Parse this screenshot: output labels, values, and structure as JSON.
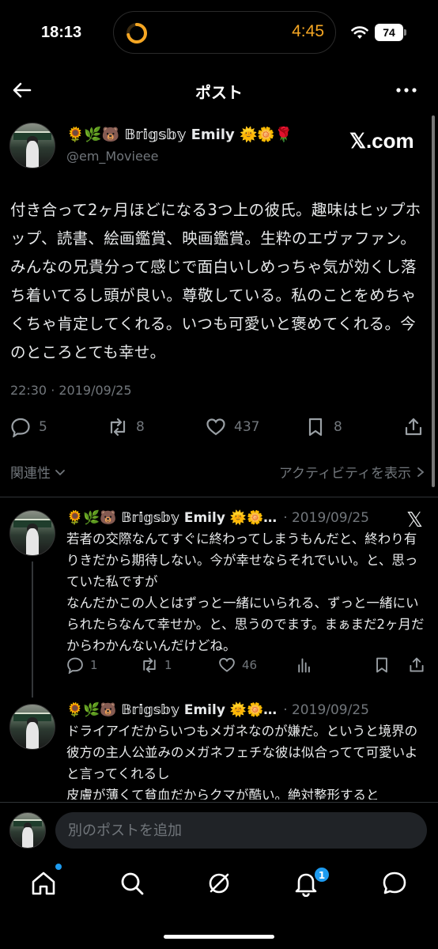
{
  "status": {
    "time": "18:13",
    "island_time": "4:45",
    "battery": "74"
  },
  "header": {
    "title": "ポスト"
  },
  "post": {
    "author_name": "🌻🌿🐻 𝔹𝕣𝕚𝕘𝕤𝕓𝕪 Emily 🌞🌼🌹",
    "handle": "@em_Movieee",
    "source": "𝕏.com",
    "body": "付き合って2ヶ月ほどになる3つ上の彼氏。趣味はヒップホップ、読書、絵画鑑賞、映画鑑賞。生粋のエヴァファン。みんなの兄貴分って感じで面白いしめっちゃ気が効くし落ち着いてるし頭が良い。尊敬している。私のことをめちゃくちゃ肯定してくれる。いつも可愛いと褒めてくれる。今のところとても幸せ。",
    "timestamp": "22:30 · 2019/09/25",
    "stats": {
      "replies": "5",
      "reposts": "8",
      "likes": "437",
      "bookmarks": "8"
    }
  },
  "filters": {
    "relevance": "関連性",
    "activity": "アクティビティを表示"
  },
  "replies": [
    {
      "author_name": "🌻🌿🐻 𝔹𝕣𝕚𝕘𝕤𝕓𝕪 Emily 🌞🌼…",
      "date": "· 2019/09/25",
      "source": "𝕏",
      "body": "若者の交際なんてすぐに終わってしまうもんだと、終わり有りきだから期待しない。今が幸せならそれでいい。と、思っていた私ですが\nなんだかこの人とはずっと一緒にいられる、ずっと一緒にいられたらなんて幸せか。と、思うのでます。まぁまだ2ヶ月だからわかんないんだけどね。",
      "stats": {
        "replies": "1",
        "reposts": "1",
        "likes": "46"
      }
    },
    {
      "author_name": "🌻🌿🐻 𝔹𝕣𝕚𝕘𝕤𝕓𝕪 Emily 🌞🌼…",
      "date": "· 2019/09/25",
      "body": "ドライアイだからいつもメガネなのが嫌だ。というと境界の彼方の主人公並みのメガネフェチな彼は似合ってて可愛いよと言ってくれるし\n皮膚が薄くて貧血だからクマが酷い。絶対整形すると"
    }
  ],
  "compose": {
    "placeholder": "別のポストを追加"
  },
  "tabbar": {
    "notification_count": "1"
  },
  "colors": {
    "accent": "#1d9bf0",
    "muted": "#71767b",
    "timer": "#f5a623"
  }
}
